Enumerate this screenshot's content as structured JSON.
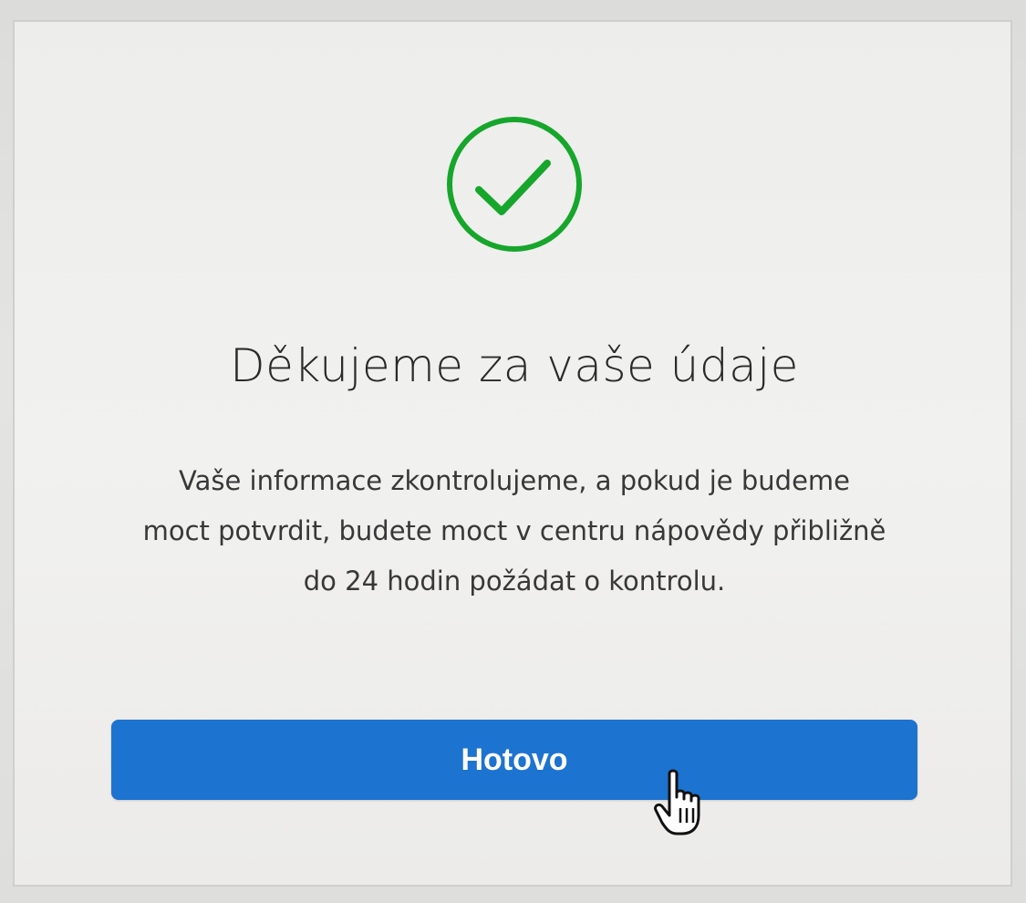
{
  "dialog": {
    "title": "Děkujeme za vaše údaje",
    "message": "Vaše informace zkontrolujeme, a pokud je budeme moct potvrdit, budete moct v centru nápovědy přibližně do 24 hodin požádat o kontrolu.",
    "done_label": "Hotovo",
    "success_icon": "checkmark-circle-icon"
  },
  "cursor": {
    "icon": "hand-pointer-cursor-icon"
  },
  "colors": {
    "success_green": "#16a62b",
    "button_blue": "#1d73d0",
    "button_text": "#ffffff",
    "title_text": "#2a2a2a",
    "body_text": "#383838"
  }
}
